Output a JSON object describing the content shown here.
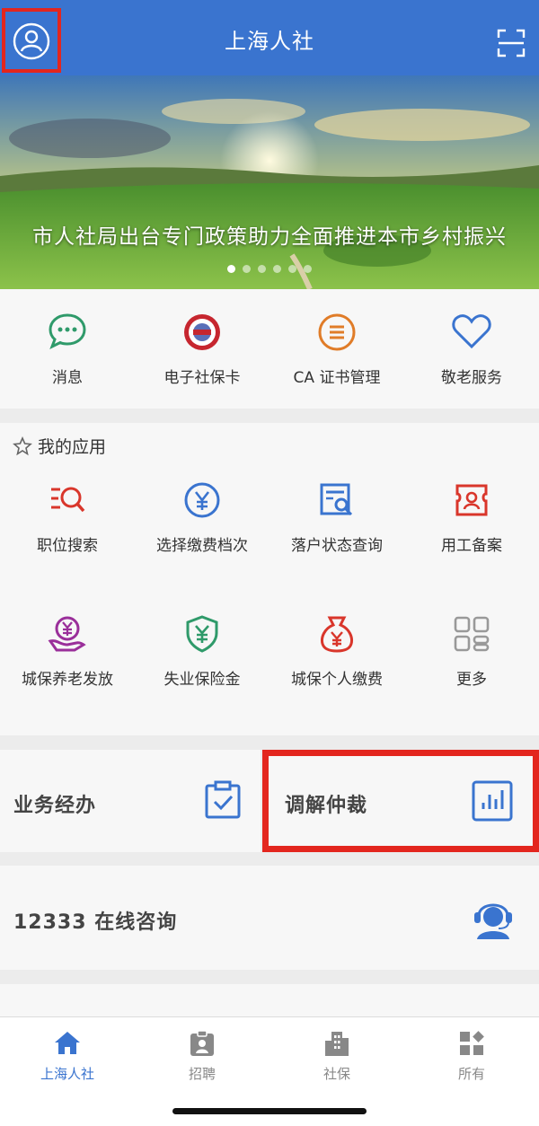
{
  "header": {
    "title": "上海人社"
  },
  "banner": {
    "caption": "市人社局出台专门政策助力全面推进本市乡村振兴",
    "dots": 6,
    "active_dot": 0
  },
  "quick_items": [
    {
      "label": "消息",
      "icon": "message-icon"
    },
    {
      "label": "电子社保卡",
      "icon": "social-security-card-icon"
    },
    {
      "label": "CA 证书管理",
      "icon": "certificate-icon"
    },
    {
      "label": "敬老服务",
      "icon": "heart-icon"
    }
  ],
  "apps": {
    "title": "我的应用",
    "items": [
      {
        "label": "职位搜索",
        "icon": "job-search-icon"
      },
      {
        "label": "选择缴费档次",
        "icon": "yuan-circle-icon"
      },
      {
        "label": "落户状态查询",
        "icon": "document-search-icon"
      },
      {
        "label": "用工备案",
        "icon": "employment-record-icon"
      },
      {
        "label": "城保养老发放",
        "icon": "pension-icon"
      },
      {
        "label": "失业保险金",
        "icon": "shield-yuan-icon"
      },
      {
        "label": "城保个人缴费",
        "icon": "money-bag-icon"
      },
      {
        "label": "更多",
        "icon": "grid-more-icon"
      }
    ]
  },
  "cards": {
    "business": "业务经办",
    "mediation": "调解仲裁",
    "consult": "12333 在线咨询"
  },
  "tabs": [
    {
      "label": "上海人社",
      "icon": "home-icon"
    },
    {
      "label": "招聘",
      "icon": "badge-icon"
    },
    {
      "label": "社保",
      "icon": "building-icon"
    },
    {
      "label": "所有",
      "icon": "all-apps-icon"
    }
  ],
  "colors": {
    "primary": "#3a74cf",
    "highlight": "#e3261e"
  }
}
